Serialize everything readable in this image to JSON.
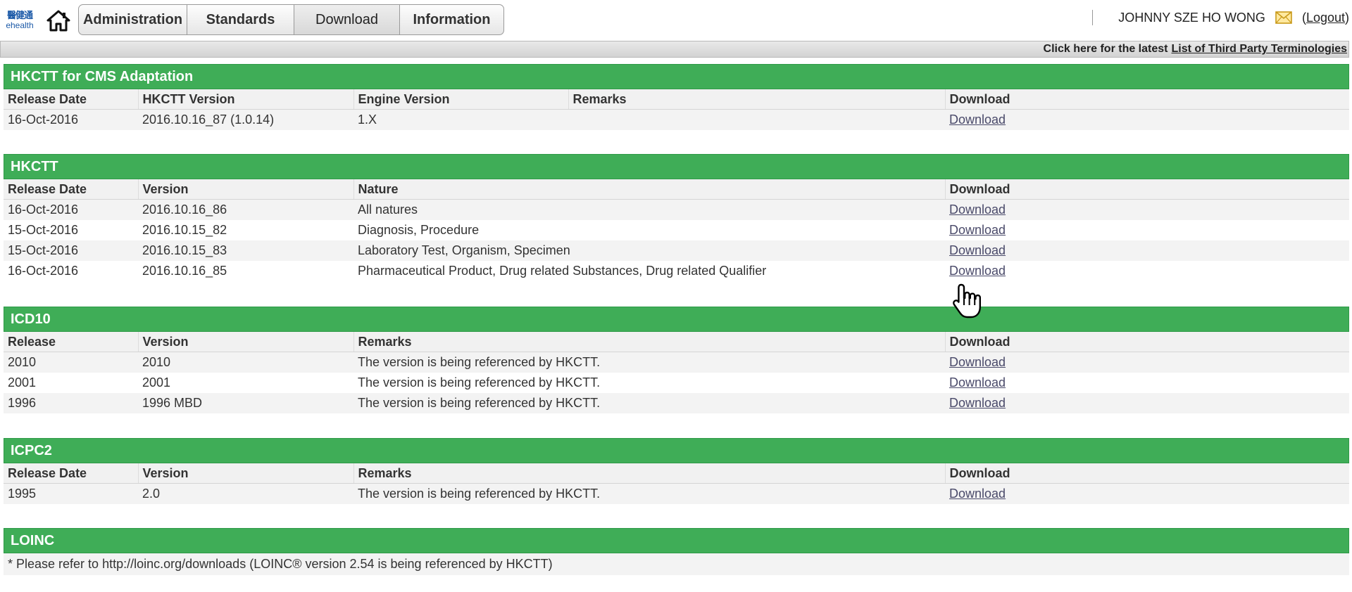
{
  "header": {
    "logo_line1": "醫健通",
    "logo_line2": "ehealth",
    "tabs": [
      {
        "label": "Administration"
      },
      {
        "label": "Standards"
      },
      {
        "label": "Download"
      },
      {
        "label": "Information"
      }
    ],
    "user_name": "JOHNNY SZE HO WONG",
    "logout_open": "(",
    "logout_label": "Logout",
    "logout_close": ")"
  },
  "info_strip": {
    "text": "Click here for the latest",
    "link_label": "List of Third Party Terminologies"
  },
  "sections": {
    "cms": {
      "title": "HKCTT for CMS Adaptation",
      "columns": [
        "Release Date",
        "HKCTT Version",
        "Engine Version",
        "Remarks",
        "Download"
      ],
      "rows": [
        {
          "date": "16-Oct-2016",
          "version": "2016.10.16_87 (1.0.14)",
          "engine": "1.X",
          "remarks": "",
          "download": "Download"
        }
      ]
    },
    "hkctt": {
      "title": "HKCTT",
      "columns": [
        "Release Date",
        "Version",
        "Nature",
        "Download"
      ],
      "rows": [
        {
          "date": "16-Oct-2016",
          "version": "2016.10.16_86",
          "nature": "All natures",
          "download": "Download"
        },
        {
          "date": "15-Oct-2016",
          "version": "2016.10.15_82",
          "nature": "Diagnosis, Procedure",
          "download": "Download"
        },
        {
          "date": "15-Oct-2016",
          "version": "2016.10.15_83",
          "nature": "Laboratory Test, Organism, Specimen",
          "download": "Download"
        },
        {
          "date": "16-Oct-2016",
          "version": "2016.10.16_85",
          "nature": "Pharmaceutical Product, Drug related Substances, Drug related Qualifier",
          "download": "Download"
        }
      ]
    },
    "icd10": {
      "title": "ICD10",
      "columns": [
        "Release",
        "Version",
        "Remarks",
        "Download"
      ],
      "rows": [
        {
          "release": "2010",
          "version": "2010",
          "remarks": "The version is being referenced by HKCTT.",
          "download": "Download"
        },
        {
          "release": "2001",
          "version": "2001",
          "remarks": "The version is being referenced by HKCTT.",
          "download": "Download"
        },
        {
          "release": "1996",
          "version": "1996 MBD",
          "remarks": "The version is being referenced by HKCTT.",
          "download": "Download"
        }
      ]
    },
    "icpc2": {
      "title": "ICPC2",
      "columns": [
        "Release Date",
        "Version",
        "Remarks",
        "Download"
      ],
      "rows": [
        {
          "date": "1995",
          "version": "2.0",
          "remarks": "The version is being referenced by HKCTT.",
          "download": "Download"
        }
      ]
    },
    "loinc": {
      "title": "LOINC",
      "note": "* Please refer to http://loinc.org/downloads (LOINC® version 2.54 is being referenced by HKCTT)"
    }
  },
  "colors": {
    "section_header": "#3fad57",
    "link": "#4a4a6a"
  },
  "icons": [
    "home-icon",
    "mail-icon",
    "hand-pointer-icon"
  ]
}
